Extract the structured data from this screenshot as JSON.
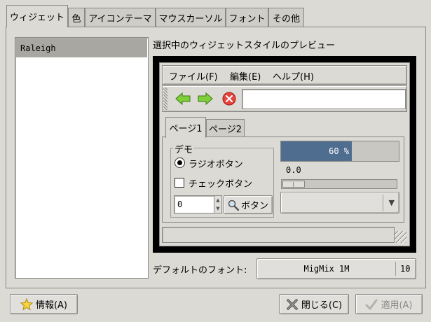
{
  "tabs": [
    {
      "label": "ウィジェット",
      "active": true
    },
    {
      "label": "色"
    },
    {
      "label": "アイコンテーマ"
    },
    {
      "label": "マウスカーソル"
    },
    {
      "label": "フォント"
    },
    {
      "label": "その他"
    }
  ],
  "theme_list": {
    "selected": "Raleigh"
  },
  "preview": {
    "title": "選択中のウィジェットスタイルのプレビュー",
    "menu": {
      "file": "ファイル(F)",
      "edit": "編集(E)",
      "help": "ヘルプ(H)"
    },
    "toolbar": {
      "entry_value": ""
    },
    "tabs": [
      "ページ1",
      "ページ2"
    ],
    "demo_frame_label": "デモ",
    "radio_label": "ラジオボタン",
    "check_label": "チェックボタン",
    "spin_value": "0",
    "button_label": "ボタン",
    "progress": {
      "value": 0.6,
      "text": "60 %"
    },
    "scale": {
      "value": 0.0,
      "text": "0.0"
    },
    "colors": {
      "progress_fill": "#4f6e8f",
      "background": "#000000"
    }
  },
  "font_row": {
    "label": "デフォルトのフォント:",
    "font_name": "MigMix 1M",
    "font_size": "10"
  },
  "footer": {
    "info_button": "情報(A)",
    "close_button": "閉じる(C)",
    "apply_button": "適用(A)"
  }
}
